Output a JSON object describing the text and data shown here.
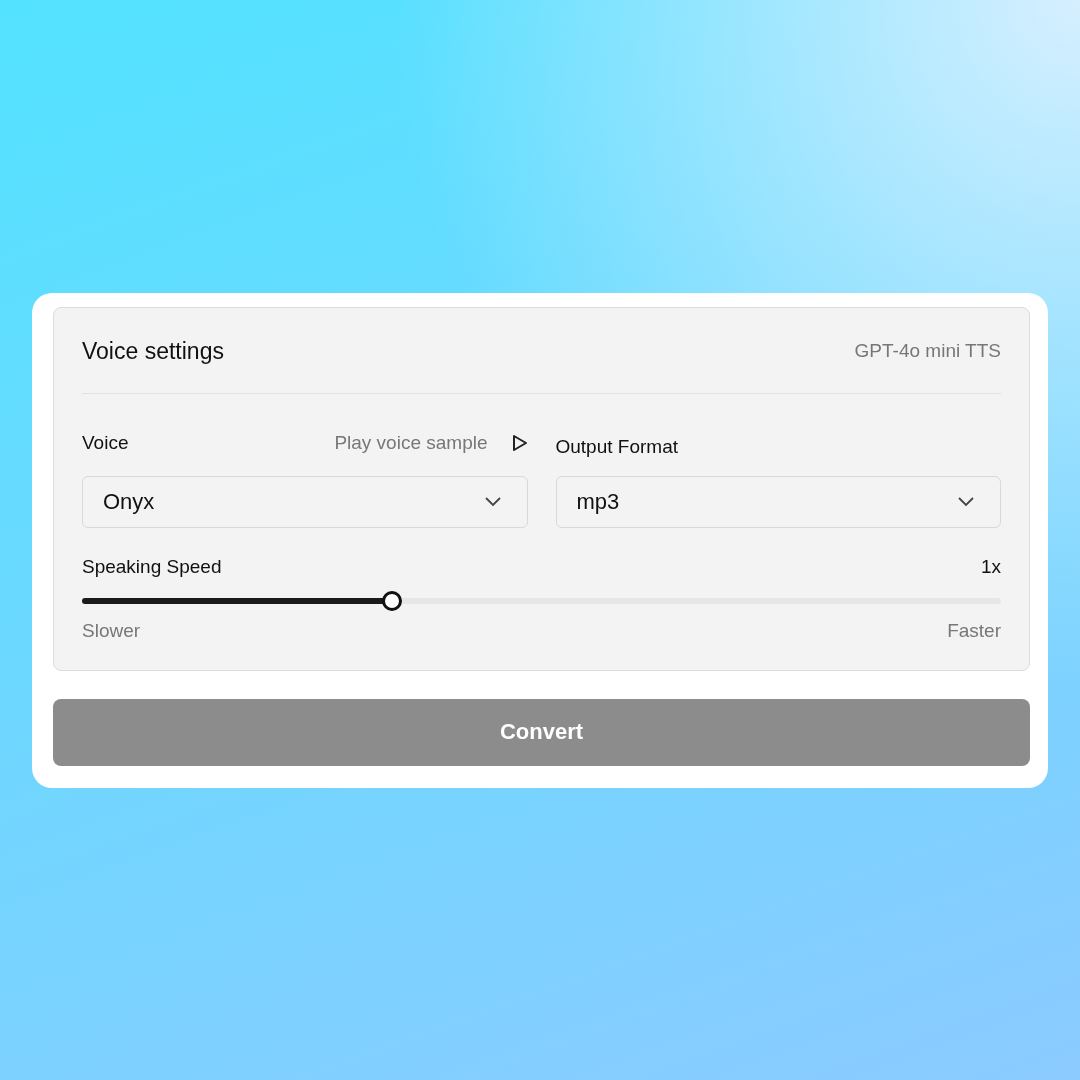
{
  "panel": {
    "title": "Voice settings",
    "model": "GPT-4o mini TTS"
  },
  "voice": {
    "label": "Voice",
    "sample_link": "Play voice sample",
    "value": "Onyx"
  },
  "output_format": {
    "label": "Output Format",
    "value": "mp3"
  },
  "speed": {
    "label": "Speaking Speed",
    "reading": "1x",
    "level": 0.337,
    "min_label": "Slower",
    "max_label": "Faster"
  },
  "button": {
    "label": "Convert",
    "disabled": true
  }
}
